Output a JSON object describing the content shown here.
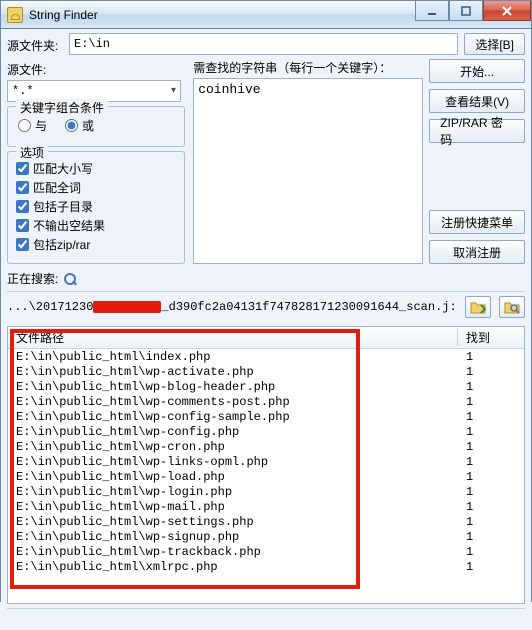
{
  "window": {
    "title": "String Finder"
  },
  "labels": {
    "source_folder": "源文件夹:",
    "browse": "选择[B]",
    "source_file": "源文件:",
    "file_pattern": "*.*",
    "keyword_group": "关键字组合条件",
    "radio_and": "与",
    "radio_or": "或",
    "options_group": "选项",
    "opt_case": "匹配大小写",
    "opt_whole": "匹配全词",
    "opt_subdir": "包括子目录",
    "opt_noempty": "不输出空结果",
    "opt_zip": "包括zip/rar",
    "search_label": "需查找的字符串（每行一个关键字）：",
    "searching": "正在搜索:",
    "col_path": "文件路径",
    "col_found": "找到"
  },
  "source_path": "E:\\in",
  "search_text": "coinhive",
  "options": {
    "radio_or": true,
    "case": true,
    "whole": true,
    "subdir": true,
    "noempty": true,
    "zip": true
  },
  "buttons": {
    "start": "开始...",
    "view_results": "查看结果(V)",
    "zip_pwd": "ZIP/RAR 密码",
    "reg_menu": "注册快捷菜单",
    "unregister": "取消注册"
  },
  "status": {
    "prefix": "...\\20171230",
    "suffix": "_d390fc2a04131f747828171230091644_scan.j:"
  },
  "results": [
    {
      "path": "E:\\in\\public_html\\index.php",
      "found": 1
    },
    {
      "path": "E:\\in\\public_html\\wp-activate.php",
      "found": 1
    },
    {
      "path": "E:\\in\\public_html\\wp-blog-header.php",
      "found": 1
    },
    {
      "path": "E:\\in\\public_html\\wp-comments-post.php",
      "found": 1
    },
    {
      "path": "E:\\in\\public_html\\wp-config-sample.php",
      "found": 1
    },
    {
      "path": "E:\\in\\public_html\\wp-config.php",
      "found": 1
    },
    {
      "path": "E:\\in\\public_html\\wp-cron.php",
      "found": 1
    },
    {
      "path": "E:\\in\\public_html\\wp-links-opml.php",
      "found": 1
    },
    {
      "path": "E:\\in\\public_html\\wp-load.php",
      "found": 1
    },
    {
      "path": "E:\\in\\public_html\\wp-login.php",
      "found": 1
    },
    {
      "path": "E:\\in\\public_html\\wp-mail.php",
      "found": 1
    },
    {
      "path": "E:\\in\\public_html\\wp-settings.php",
      "found": 1
    },
    {
      "path": "E:\\in\\public_html\\wp-signup.php",
      "found": 1
    },
    {
      "path": "E:\\in\\public_html\\wp-trackback.php",
      "found": 1
    },
    {
      "path": "E:\\in\\public_html\\xmlrpc.php",
      "found": 1
    }
  ]
}
